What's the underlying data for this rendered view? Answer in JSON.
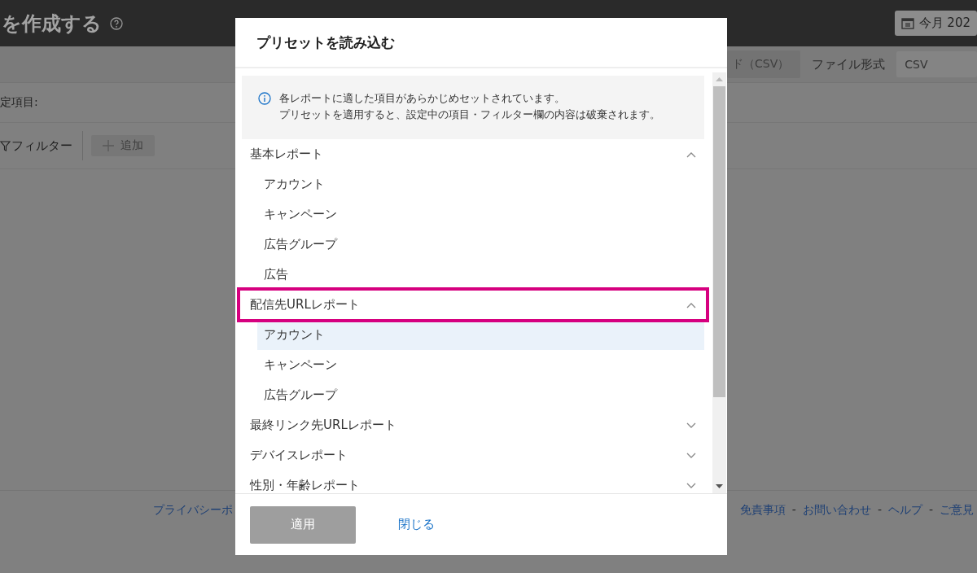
{
  "page": {
    "title": "を作成する",
    "date_button": "今月 202",
    "download_button": "ド（CSV）",
    "file_format_label": "ファイル形式",
    "file_format_value": "CSV",
    "settings_label": "定項目:",
    "filter_label": "フィルター",
    "add_button": "追加",
    "footer_left": [
      {
        "kind": "link",
        "text": "プライバシーポ"
      }
    ],
    "footer_right": [
      {
        "kind": "link",
        "text": "免責事項"
      },
      {
        "kind": "separator",
        "text": "-"
      },
      {
        "kind": "link",
        "text": "お問い合わせ"
      },
      {
        "kind": "separator",
        "text": "-"
      },
      {
        "kind": "link",
        "text": "ヘルプ"
      },
      {
        "kind": "separator",
        "text": "-"
      },
      {
        "kind": "link",
        "text": "ご意見"
      }
    ]
  },
  "dialog": {
    "title": "プリセットを読み込む",
    "notice": [
      "各レポートに適した項目があらかじめセットされています。",
      "プリセットを適用すると、設定中の項目・フィルター欄の内容は破棄されます。"
    ],
    "groups": [
      {
        "label": "基本レポート",
        "expanded": true,
        "highlighted": false,
        "children": [
          {
            "label": "アカウント",
            "selected": false
          },
          {
            "label": "キャンペーン",
            "selected": false
          },
          {
            "label": "広告グループ",
            "selected": false
          },
          {
            "label": "広告",
            "selected": false
          }
        ]
      },
      {
        "label": "配信先URLレポート",
        "expanded": true,
        "highlighted": true,
        "children": [
          {
            "label": "アカウント",
            "selected": true
          },
          {
            "label": "キャンペーン",
            "selected": false
          },
          {
            "label": "広告グループ",
            "selected": false
          }
        ]
      },
      {
        "label": "最終リンク先URLレポート",
        "expanded": false,
        "highlighted": false
      },
      {
        "label": "デバイスレポート",
        "expanded": false,
        "highlighted": false
      },
      {
        "label": "性別・年齢レポート",
        "expanded": false,
        "highlighted": false
      }
    ],
    "apply_button": {
      "label": "適用",
      "disabled": true
    },
    "close_link": "閉じる"
  }
}
